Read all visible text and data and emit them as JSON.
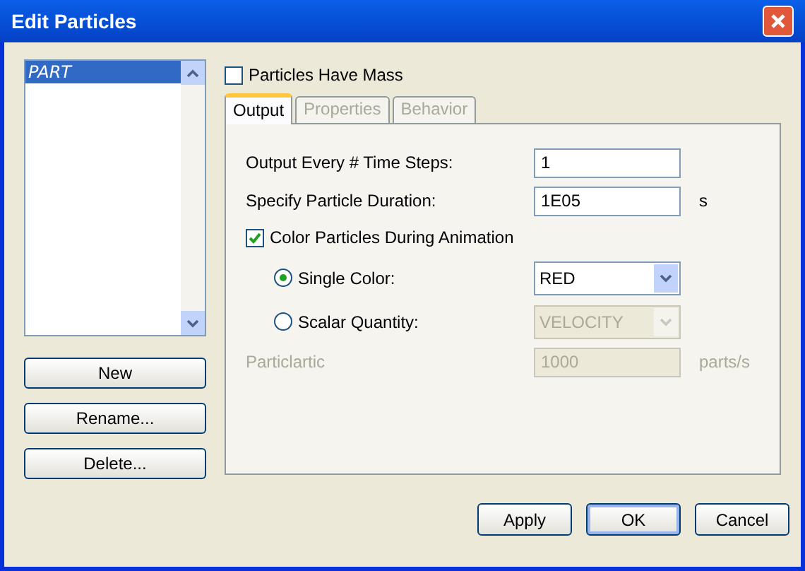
{
  "window": {
    "title": "Edit Particles"
  },
  "particle_list": {
    "items": [
      {
        "label": "PART",
        "selected": true
      }
    ]
  },
  "list_buttons": [
    "New",
    "Rename...",
    "Delete..."
  ],
  "particles_have_mass": {
    "label": "Particles Have Mass",
    "checked": false
  },
  "tabs": [
    {
      "label": "Output",
      "selected": true,
      "disabled": false
    },
    {
      "label": "Properties",
      "selected": false,
      "disabled": true
    },
    {
      "label": "Behavior",
      "selected": false,
      "disabled": true
    }
  ],
  "output": {
    "rows": [
      {
        "label": "Output Every # Time Steps:",
        "value": "1"
      },
      {
        "label": "Specify Particle Duration:",
        "value": "1E05",
        "unit": "s"
      }
    ],
    "color_particles": {
      "label": "Color Particles During Animation",
      "checked": true
    },
    "color_modes": [
      {
        "label": "Single Color:",
        "selected": true,
        "value": "RED",
        "disabled": false
      },
      {
        "label": "Scalar Quantity:",
        "selected": false,
        "value": "VELOCITY",
        "disabled": true
      }
    ],
    "rate": {
      "label": "Particlartic",
      "value": "1000",
      "unit": "parts/s",
      "disabled": true
    }
  },
  "buttons": [
    "Apply",
    "OK",
    "Cancel"
  ]
}
